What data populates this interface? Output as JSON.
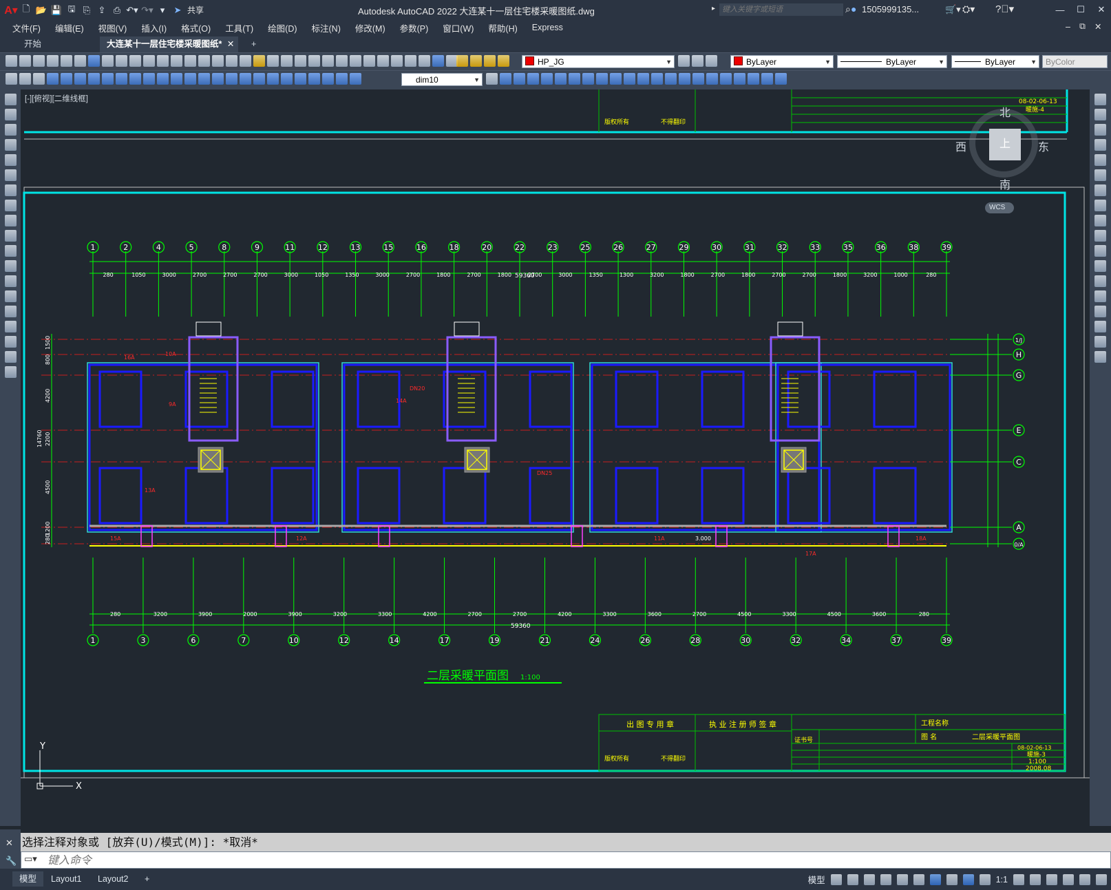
{
  "title_bar": {
    "app_title": "Autodesk AutoCAD 2022    大连某十一层住宅楼采暖图纸.dwg",
    "share_label": "共享",
    "search_placeholder": "键入关键字或短语",
    "user_name": "1505999135..."
  },
  "menu": [
    "文件(F)",
    "编辑(E)",
    "视图(V)",
    "插入(I)",
    "格式(O)",
    "工具(T)",
    "绘图(D)",
    "标注(N)",
    "修改(M)",
    "参数(P)",
    "窗口(W)",
    "帮助(H)",
    "Express"
  ],
  "tabs": {
    "start": "开始",
    "document": "大连某十一层住宅楼采暖图纸*",
    "close": "✕",
    "add": "+"
  },
  "properties": {
    "layer": "HP_JG",
    "color": "ByLayer",
    "linetype": "ByLayer",
    "lineweight": "ByLayer",
    "plotstyle": "ByColor",
    "dimstyle": "dim10"
  },
  "viewport_label": "[-][俯视][二维线框]",
  "viewcube": {
    "top": "上",
    "north": "北",
    "south": "南",
    "west": "西",
    "east": "东",
    "wcs": "WCS"
  },
  "ucs": {
    "y": "Y",
    "x": "X"
  },
  "drawing": {
    "title": "二层采暖平面图",
    "scale": "1:100",
    "total_dim_top": "59360",
    "total_dim_bottom": "59360",
    "top_axes": [
      "1",
      "2",
      "4",
      "5",
      "8",
      "9",
      "11",
      "12",
      "13",
      "15",
      "16",
      "18",
      "20",
      "22",
      "23",
      "25",
      "26",
      "27",
      "29",
      "30",
      "31",
      "32",
      "33",
      "35",
      "36",
      "38",
      "39"
    ],
    "bottom_axes": [
      "1",
      "3",
      "6",
      "7",
      "10",
      "12",
      "14",
      "17",
      "19",
      "21",
      "24",
      "26",
      "28",
      "30",
      "32",
      "34",
      "37",
      "39"
    ],
    "right_axes": [
      "1/J",
      "H",
      "G",
      "E",
      "C",
      "A",
      "0/A"
    ],
    "top_dims": [
      "280",
      "1050",
      "3000",
      "2700",
      "2700",
      "2700",
      "3000",
      "1050",
      "1350",
      "3000",
      "2700",
      "1800",
      "2700",
      "1800",
      "2700",
      "3000",
      "1350",
      "1300",
      "3200",
      "1800",
      "2700",
      "1800",
      "2700",
      "2700",
      "1800",
      "3200",
      "1000",
      "280"
    ],
    "bottom_dims": [
      "280",
      "3200",
      "3900",
      "2000",
      "3900",
      "3200",
      "3300",
      "4200",
      "2700",
      "2700",
      "4200",
      "3300",
      "3600",
      "2700",
      "4500",
      "3300",
      "4500",
      "3600",
      "280"
    ],
    "left_dims": [
      "14760",
      "1500",
      "800",
      "4200",
      "2200",
      "4500",
      "1200",
      "280"
    ],
    "room_labels": [
      "16A",
      "10A",
      "9A",
      "14A",
      "15A",
      "12A",
      "17A",
      "18A",
      "13A",
      "11A",
      "3.000",
      "DN25",
      "DN20"
    ],
    "title_block": {
      "c1": "出 图 专 用 章",
      "c2": "执 业 注 册 师 签 章",
      "project": "工程名称",
      "drawing_name_label": "图  名",
      "drawing_name": "二层采暖平面图",
      "cert": "证书号",
      "sheet_no": "暖施-3",
      "scale": "1:100",
      "date": "2008.08",
      "copyright": "版权所有",
      "nocopy": "不得翻印",
      "code": "08-02-06-13",
      "sheet_no_top": "暖施-4"
    }
  },
  "command": {
    "history": "选择注释对象或 [放弃(U)/模式(M)]: *取消*",
    "placeholder": "键入命令"
  },
  "status": {
    "model_tab": "模型",
    "layout1": "Layout1",
    "layout2": "Layout2",
    "add": "+",
    "model_text": "模型",
    "scale": "1:1"
  }
}
